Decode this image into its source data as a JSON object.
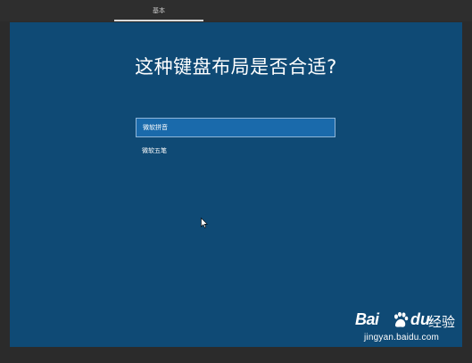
{
  "header": {
    "tab_label": "基本"
  },
  "main": {
    "title": "这种键盘布局是否合适?",
    "options": [
      {
        "label": "微软拼音",
        "selected": true
      },
      {
        "label": "微软五笔",
        "selected": false
      }
    ]
  },
  "watermark": {
    "logo_text_left": "Bai",
    "logo_text_right": "du",
    "logo_suffix": "经验",
    "url": "jingyan.baidu.com"
  },
  "colors": {
    "panel_bg": "#0f4a75",
    "selected_bg": "#1a6aab",
    "frame_bg": "#2b2b2b"
  },
  "icons": {
    "cursor": "mouse-pointer-icon",
    "paw": "baidu-paw-icon"
  }
}
